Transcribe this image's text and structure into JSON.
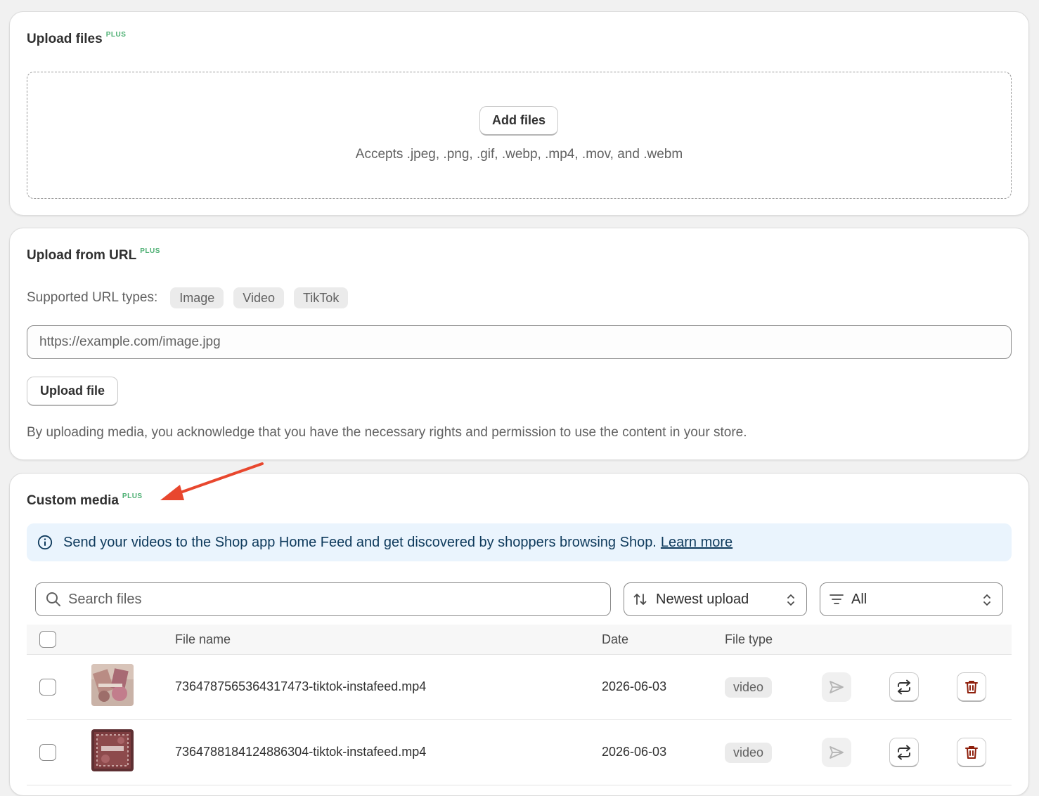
{
  "upload_files": {
    "title": "Upload files",
    "badge": "PLUS",
    "add_files_label": "Add files",
    "accepts_text": "Accepts .jpeg, .png, .gif, .webp, .mp4, .mov, and .webm"
  },
  "upload_url": {
    "title": "Upload from URL",
    "badge": "PLUS",
    "supported_label": "Supported URL types:",
    "types": [
      "Image",
      "Video",
      "TikTok"
    ],
    "input_value": "https://example.com/image.jpg",
    "upload_button": "Upload file",
    "disclaimer": "By uploading media, you acknowledge that you have the necessary rights and permission to use the content in your store."
  },
  "custom_media": {
    "title": "Custom media",
    "badge": "PLUS",
    "banner_text": "Send your videos to the Shop app Home Feed and get discovered by shoppers browsing Shop.",
    "banner_link": "Learn more",
    "search_placeholder": "Search files",
    "sort_value": "Newest upload",
    "filter_value": "All",
    "columns": {
      "file_name": "File name",
      "date": "Date",
      "file_type": "File type"
    },
    "rows": [
      {
        "file_name": "7364787565364317473-tiktok-instafeed.mp4",
        "date": "2026-06-03",
        "type": "video"
      },
      {
        "file_name": "7364788184124886304-tiktok-instafeed.mp4",
        "date": "2026-06-03",
        "type": "video"
      }
    ]
  },
  "colors": {
    "plus_badge": "#4caf72",
    "annotation_arrow": "#e8472e",
    "banner_bg": "#eaf4fd",
    "delete_icon": "#8e1f0b"
  },
  "icons": [
    "info-icon",
    "search-icon",
    "sort-arrows-icon",
    "filter-lines-icon",
    "chevron-updown-icon",
    "send-icon",
    "replace-icon",
    "trash-icon"
  ]
}
